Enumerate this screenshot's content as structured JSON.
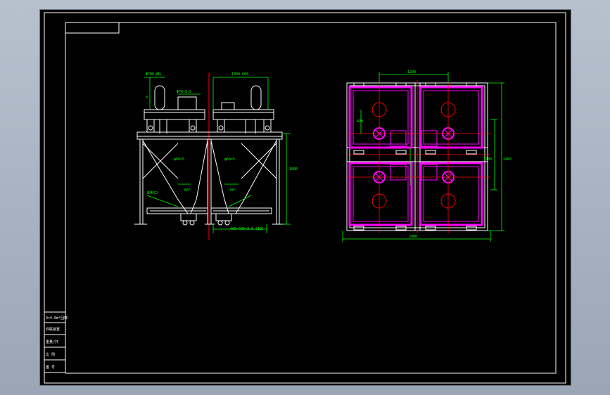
{
  "colors": {
    "background": "#000000",
    "frame": "#ffffff",
    "steel": "#ffffff",
    "dimension": "#00ff00",
    "centerline": "#ff0000",
    "hopper_outline": "#ff00ff",
    "title_block": "#ffffff"
  },
  "title_block": {
    "rows": [
      "4×4.0m²回转",
      "四联装置",
      "重量/共",
      "比 例",
      "图 号"
    ]
  },
  "front_view": {
    "dimensions": {
      "top_left": "Φ700(两)",
      "top_right": "1000 600",
      "pipe": "Φ76×3.5",
      "height": "1800",
      "side": "8",
      "hopper_left": "φ60×5",
      "hopper_right": "φ60×5",
      "outlet": "卸料口",
      "angle_left": "60°",
      "angle_right": "60°",
      "bottom": "400×400×3.0 (10)"
    }
  },
  "plan_view": {
    "dimensions": {
      "top": "1200",
      "bottom": "2400",
      "right_outer": "2400",
      "right_inner": "1200",
      "left_small": "420"
    }
  }
}
